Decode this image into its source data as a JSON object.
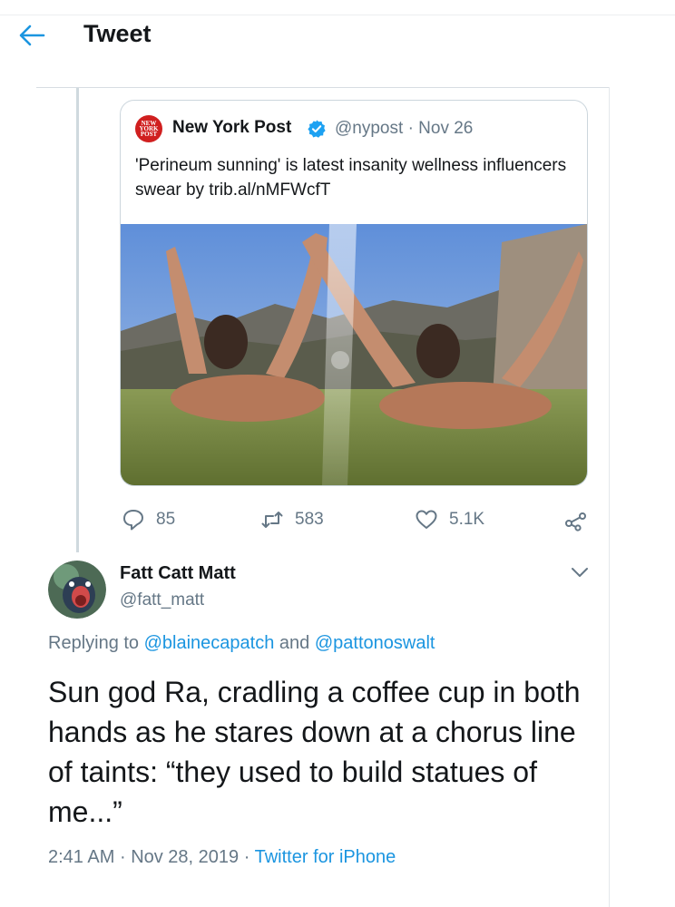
{
  "header": {
    "title": "Tweet",
    "back_icon": "arrow-left-icon"
  },
  "colors": {
    "accent": "#1b95e0",
    "text": "#14171a",
    "secondary_text": "#657786",
    "border": "#ccd6dd"
  },
  "quoted_tweet": {
    "avatar_logo_text": "NEW YORK POST",
    "name": "New York Post",
    "verified_icon": "verified-badge-icon",
    "handle": "@nypost",
    "separator": "·",
    "date": "Nov 26",
    "text": "'Perineum sunning' is latest insanity wellness influencers swear by trib.al/nMFWcfT",
    "image_icon": "photo-icon"
  },
  "actions": {
    "reply": {
      "icon": "reply-icon",
      "count": "85"
    },
    "retweet": {
      "icon": "retweet-icon",
      "count": "583"
    },
    "like": {
      "icon": "heart-icon",
      "count": "5.1K"
    },
    "share": {
      "icon": "share-icon"
    }
  },
  "tweet": {
    "author_name": "Fatt Catt Matt",
    "author_handle": "@fatt_matt",
    "caret_icon": "chevron-down-icon",
    "replying_prefix": "Replying to",
    "replying_to": [
      "@blainecapatch",
      "@pattonoswalt"
    ],
    "replying_and": "and",
    "text": "Sun god Ra, cradling a coffee cup in both hands as he stares down at a chorus line of taints: “they used to build statues of me...”",
    "time": "2:41 AM",
    "date": "Nov 28, 2019",
    "separator": "·",
    "source": "Twitter for iPhone"
  }
}
